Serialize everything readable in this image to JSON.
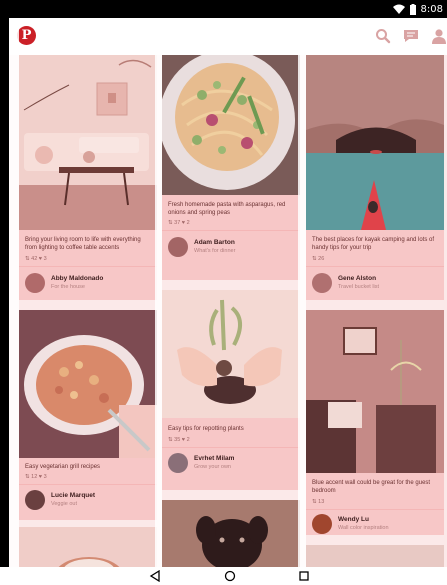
{
  "status_bar": {
    "time": "8:08"
  },
  "toolbar": {
    "brand_icon": "pinterest-logo",
    "brand_letter": "P"
  },
  "columns": [
    {
      "pins": [
        {
          "description": "Bring your living room to life with everything from lighting to coffee table accents",
          "saves": "42",
          "likes": "3",
          "author": "Abby Maldonado",
          "board": "For the house"
        },
        {
          "description": "Easy vegetarian grill recipes",
          "saves": "12",
          "likes": "3",
          "author": "Lucie Marquet",
          "board": "Veggie out"
        }
      ]
    },
    {
      "pins": [
        {
          "description": "Fresh homemade pasta with asparagus, red onions and spring peas",
          "saves": "37",
          "likes": "2",
          "author": "Adam Barton",
          "board": "What's for dinner"
        },
        {
          "description": "Easy tips for repotting plants",
          "saves": "35",
          "likes": "2",
          "author": "Evrhet Milam",
          "board": "Grow your own"
        }
      ]
    },
    {
      "pins": [
        {
          "description": "The best places for kayak camping and lots of handy tips for your trip",
          "saves": "26",
          "author": "Gene Alston",
          "board": "Travel bucket list"
        },
        {
          "description": "Blue accent wall could be great for the guest bedroom",
          "saves": "13",
          "author": "Wendy Lu",
          "board": "Wall color inspiration"
        }
      ]
    }
  ],
  "colors": {
    "brand": "#cb2027",
    "overlay": "#f7c7c7"
  }
}
